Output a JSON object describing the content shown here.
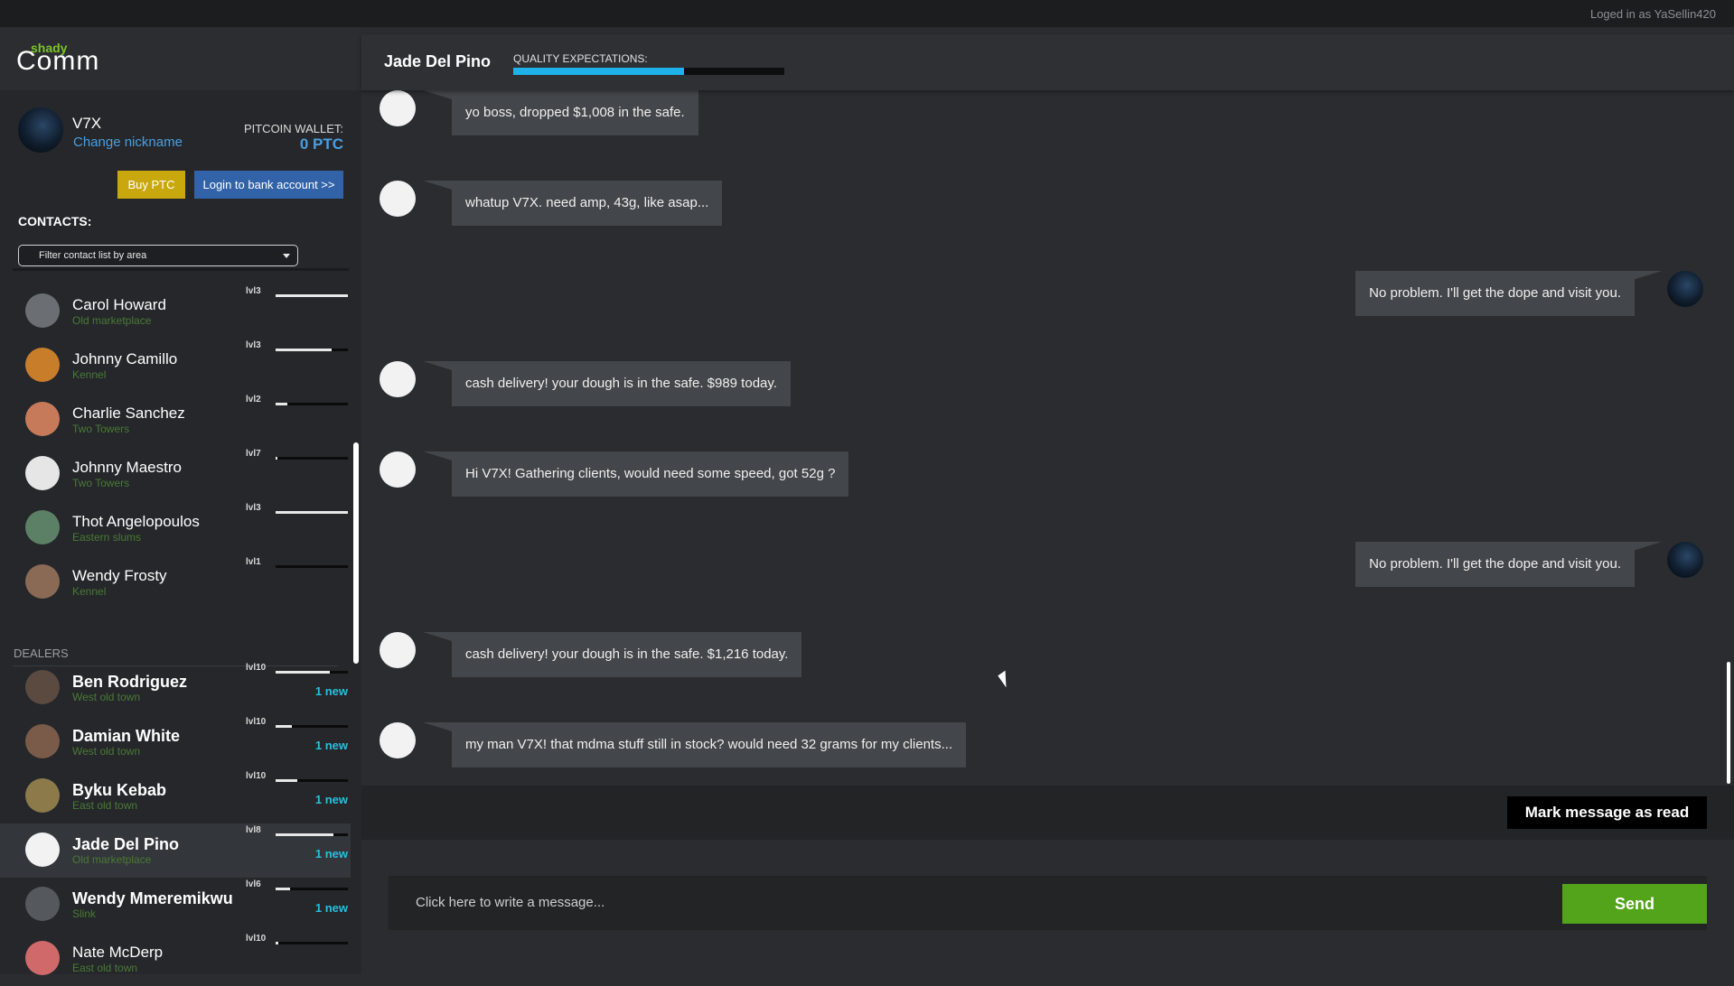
{
  "topbar": {
    "login_text": "Loged in as YaSellin420"
  },
  "logo": {
    "small": "shady",
    "big": "Comm"
  },
  "profile": {
    "nickname": "V7X",
    "change_nickname": "Change nickname",
    "wallet_label": "PITCOIN WALLET:",
    "wallet_value": "0 PTC",
    "buy_label": "Buy PTC",
    "bank_label": "Login to bank account >>"
  },
  "contacts": {
    "title": "CONTACTS:",
    "filter_label": "Filter contact list by area",
    "dealers_label": "DEALERS",
    "items": [
      {
        "name": "Carol Howard",
        "area": "Old marketplace",
        "level": "lvl3",
        "fill": 1.0,
        "avatar_color": "#6b6f73",
        "bold": false,
        "new": ""
      },
      {
        "name": "Johnny Camillo",
        "area": "Kennel",
        "level": "lvl3",
        "fill": 0.78,
        "avatar_color": "#c87d2a",
        "bold": false,
        "new": ""
      },
      {
        "name": "Charlie Sanchez",
        "area": "Two Towers",
        "level": "lvl2",
        "fill": 0.16,
        "avatar_color": "#c77a5a",
        "bold": false,
        "new": ""
      },
      {
        "name": "Johnny Maestro",
        "area": "Two Towers",
        "level": "lvl7",
        "fill": 0.02,
        "avatar_color": "#e6e6e6",
        "bold": false,
        "new": ""
      },
      {
        "name": "Thot Angelopoulos",
        "area": "Eastern slums",
        "level": "lvl3",
        "fill": 1.0,
        "avatar_color": "#5c8066",
        "bold": false,
        "new": ""
      },
      {
        "name": "Wendy Frosty",
        "area": "Kennel",
        "level": "lvl1",
        "fill": 0.0,
        "avatar_color": "#8a6a55",
        "bold": false,
        "new": ""
      }
    ],
    "dealers": [
      {
        "name": "Ben Rodriguez",
        "area": "West old town",
        "level": "lvl10",
        "fill": 0.75,
        "avatar_color": "#5a4a40",
        "bold": true,
        "new": "1 new"
      },
      {
        "name": "Damian White",
        "area": "West old town",
        "level": "lvl10",
        "fill": 0.22,
        "avatar_color": "#7a5a48",
        "bold": true,
        "new": "1 new"
      },
      {
        "name": "Byku Kebab",
        "area": "East old town",
        "level": "lvl10",
        "fill": 0.3,
        "avatar_color": "#8c7a4a",
        "bold": true,
        "new": "1 new"
      },
      {
        "name": "Jade Del Pino",
        "area": "Old marketplace",
        "level": "lvl8",
        "fill": 0.8,
        "avatar_color": "#f2f2f2",
        "bold": true,
        "new": "1 new"
      },
      {
        "name": "Wendy Mmeremikwu",
        "area": "Slink",
        "level": "lvl6",
        "fill": 0.2,
        "avatar_color": "#55595d",
        "bold": true,
        "new": "1 new"
      },
      {
        "name": "Nate McDerp",
        "area": "East old town",
        "level": "lvl10",
        "fill": 0.04,
        "avatar_color": "#d06a6a",
        "bold": false,
        "new": ""
      }
    ]
  },
  "chat": {
    "name": "Jade Del Pino",
    "quality_label": "QUALITY EXPECTATIONS:",
    "quality_fill": 0.63,
    "messages": [
      {
        "dir": "in",
        "text": "yo boss, dropped $1,008 in the safe."
      },
      {
        "dir": "in",
        "text": "whatup V7X. need amp, 43g, like asap..."
      },
      {
        "dir": "out",
        "text": "No problem. I'll get the dope and visit you."
      },
      {
        "dir": "in",
        "text": "cash delivery! your dough is in the safe. $989 today."
      },
      {
        "dir": "in",
        "text": "Hi V7X! Gathering clients, would need some speed, got 52g ?"
      },
      {
        "dir": "out",
        "text": "No problem. I'll get the dope and visit you."
      },
      {
        "dir": "in",
        "text": "cash delivery! your dough is in the safe. $1,216 today."
      },
      {
        "dir": "in",
        "text": "my man V7X! that mdma stuff still in stock? would need 32 grams for my clients..."
      }
    ],
    "mark_read_label": "Mark message as read",
    "compose_placeholder": "Click here to write a message...",
    "send_label": "Send"
  },
  "colors": {
    "accent_blue": "#4a9fe0",
    "send_green": "#53a31b",
    "new_cyan": "#28c0e0",
    "buy_gold": "#c9a80e"
  }
}
